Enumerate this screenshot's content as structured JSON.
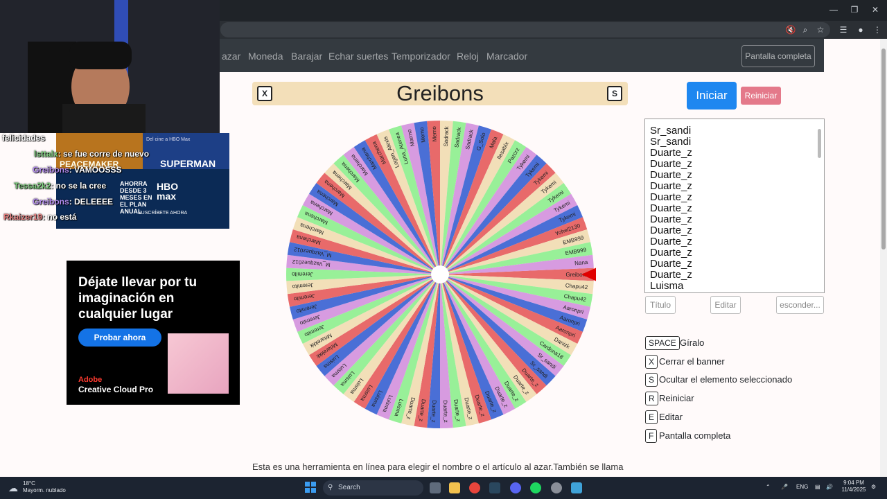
{
  "page": {
    "nav": [
      "azar",
      "Moneda",
      "Barajar",
      "Echar suertes",
      "Temporizador",
      "Reloj",
      "Marcador"
    ],
    "fullscreen_btn": "Pantalla completa",
    "title": "Greibons",
    "close_key": "X",
    "hide_key": "S",
    "start_btn": "Iniciar",
    "reset_btn": "Reiniciar",
    "names_list": [
      "Sr_sandi",
      "Sr_sandi",
      "Duarte_z",
      "Duarte_z",
      "Duarte_z",
      "Duarte_z",
      "Duarte_z",
      "Duarte_z",
      "Duarte_z",
      "Duarte_z",
      "Duarte_z",
      "Duarte_z",
      "Duarte_z",
      "Duarte_z",
      "Luisma"
    ],
    "title_btn": "Título",
    "edit_btn": "Editar",
    "hide_btn": "esconder...",
    "shortcuts": [
      {
        "key": "SPACE",
        "label": "Gíralo"
      },
      {
        "key": "X",
        "label": "Cerrar el banner"
      },
      {
        "key": "S",
        "label": "Ocultar el elemento seleccionado"
      },
      {
        "key": "R",
        "label": "Reiniciar"
      },
      {
        "key": "E",
        "label": "Editar"
      },
      {
        "key": "F",
        "label": "Pantalla completa"
      }
    ],
    "description": "Esta es una herramienta en línea para elegir el nombre o el artículo al azar.También se llama"
  },
  "wheel": {
    "segment_colors": [
      "#e86a6a",
      "#f2dfb8",
      "#98f098",
      "#d79be0",
      "#4a6fd6"
    ],
    "pointer_color": "#e00000",
    "labels": [
      "Greibons",
      "Chapu42",
      "Chapu42",
      "Aaronpri",
      "Aaronpri",
      "Aaronpri",
      "Danizk",
      "Cardona18",
      "Sr_sandi",
      "Sr_sandi",
      "Duarte_z",
      "Duarte_z",
      "Duarte_z",
      "Duarte_z",
      "Duarte_z",
      "Duarte_z",
      "Duarte_z",
      "Duarte_z",
      "Duarte_z",
      "Duarte_z",
      "Duarte_z",
      "Duarte_z",
      "Luisma",
      "Luisma",
      "Luisma",
      "Luisma",
      "Luisma",
      "Luisma",
      "Luisma",
      "Luisma",
      "Mrlarekkk",
      "Mrlarekkk",
      "Jeremito",
      "Jeremito",
      "Jeremito",
      "Jeremito",
      "Jeremito",
      "Jeremito",
      "M_Vazquez012",
      "M_Vazquez012",
      "Marchena",
      "Marchena",
      "Marchena",
      "Marchena",
      "Marchena",
      "Marchena",
      "Marchena",
      "Marchena",
      "Marchena",
      "Marchena",
      "Marchena",
      "Logan_Alexis",
      "Luna_Atenea",
      "Marmo",
      "Memo",
      "Memo",
      "Sadrack",
      "Sadrack",
      "Sadrack",
      "G_Solo",
      "Mala",
      "Ilesabix",
      "Pazcrz",
      "Tykemi",
      "Tykemi",
      "Tykemi",
      "Tykemi",
      "Tykemi",
      "Tykemi",
      "Tykemi",
      "Yohel2130",
      "EMB999",
      "EMB999",
      "Nana"
    ]
  },
  "stream": {
    "chat": [
      {
        "user": "felicidades",
        "msg": ""
      },
      {
        "user": "lsttalx",
        "msg": ": se fue corre de nuevo"
      },
      {
        "user": "Greibons",
        "msg": ": VAMOOSSS"
      },
      {
        "user": "Tessa2k2",
        "msg": ": no se la cree"
      },
      {
        "user": "Greibons",
        "msg": ": DELEEEE"
      },
      {
        "user": "Rkaizer19",
        "msg": ": no está"
      }
    ],
    "chat_ad": {
      "top": "Del cine a HBO Max",
      "left": "PEACEMAKER",
      "right": "SUPERMAN",
      "mid": "AHORRA DESDE 3 MESES EN EL PLAN ANUAL",
      "logo": "HBO max",
      "cta": "SUSCRÍBETE AHORA"
    }
  },
  "ad": {
    "headline": "Déjate llevar por tu imaginación en cualquier lugar",
    "cta": "Probar ahora",
    "brand": "Adobe",
    "product": "Creative Cloud Pro"
  },
  "taskbar": {
    "temp": "18°C",
    "weather": "Mayorm. nublado",
    "search": "Search",
    "lang": "ENG",
    "time": "9:04 PM",
    "date": "11/4/2025"
  }
}
